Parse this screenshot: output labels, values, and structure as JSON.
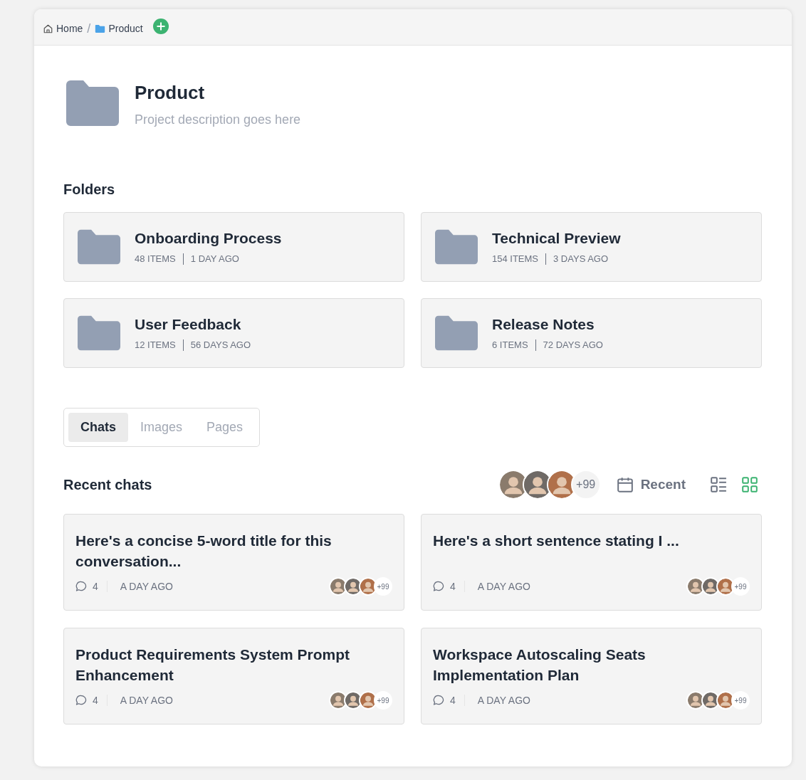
{
  "breadcrumb_separator": "/",
  "breadcrumb": [
    {
      "label": "Home",
      "kind": "home"
    },
    {
      "label": "Product",
      "kind": "folder"
    }
  ],
  "project": {
    "title": "Product",
    "description": "Project description goes here"
  },
  "folders_heading": "Folders",
  "folders": [
    {
      "name": "Onboarding Process",
      "items": "48 ITEMS",
      "updated": "1 DAY AGO"
    },
    {
      "name": "Technical Preview",
      "items": "154 ITEMS",
      "updated": "3 DAYS AGO"
    },
    {
      "name": "User Feedback",
      "items": "12 ITEMS",
      "updated": "56 DAYS AGO"
    },
    {
      "name": "Release Notes",
      "items": "6 ITEMS",
      "updated": "72 DAYS AGO"
    }
  ],
  "tabs": [
    {
      "label": "Chats",
      "selected": true
    },
    {
      "label": "Images",
      "selected": false
    },
    {
      "label": "Pages",
      "selected": false
    }
  ],
  "recent": {
    "heading": "Recent chats",
    "members_more": "+99",
    "sort": "Recent",
    "views": [
      {
        "kind": "list",
        "selected": false
      },
      {
        "kind": "grid",
        "selected": true
      }
    ]
  },
  "chats": [
    {
      "title": "Here's a concise 5-word title for this conversation...",
      "comments": "4",
      "time": "A DAY AGO",
      "more": "+99"
    },
    {
      "title": "Here's a short sentence stating I ...",
      "comments": "4",
      "time": "A DAY AGO",
      "more": "+99"
    },
    {
      "title": "Product Requirements System Prompt Enhancement",
      "comments": "4",
      "time": "A DAY AGO",
      "more": "+99"
    },
    {
      "title": "Workspace Autoscaling Seats Implementation Plan",
      "comments": "4",
      "time": "A DAY AGO",
      "more": "+99"
    }
  ]
}
